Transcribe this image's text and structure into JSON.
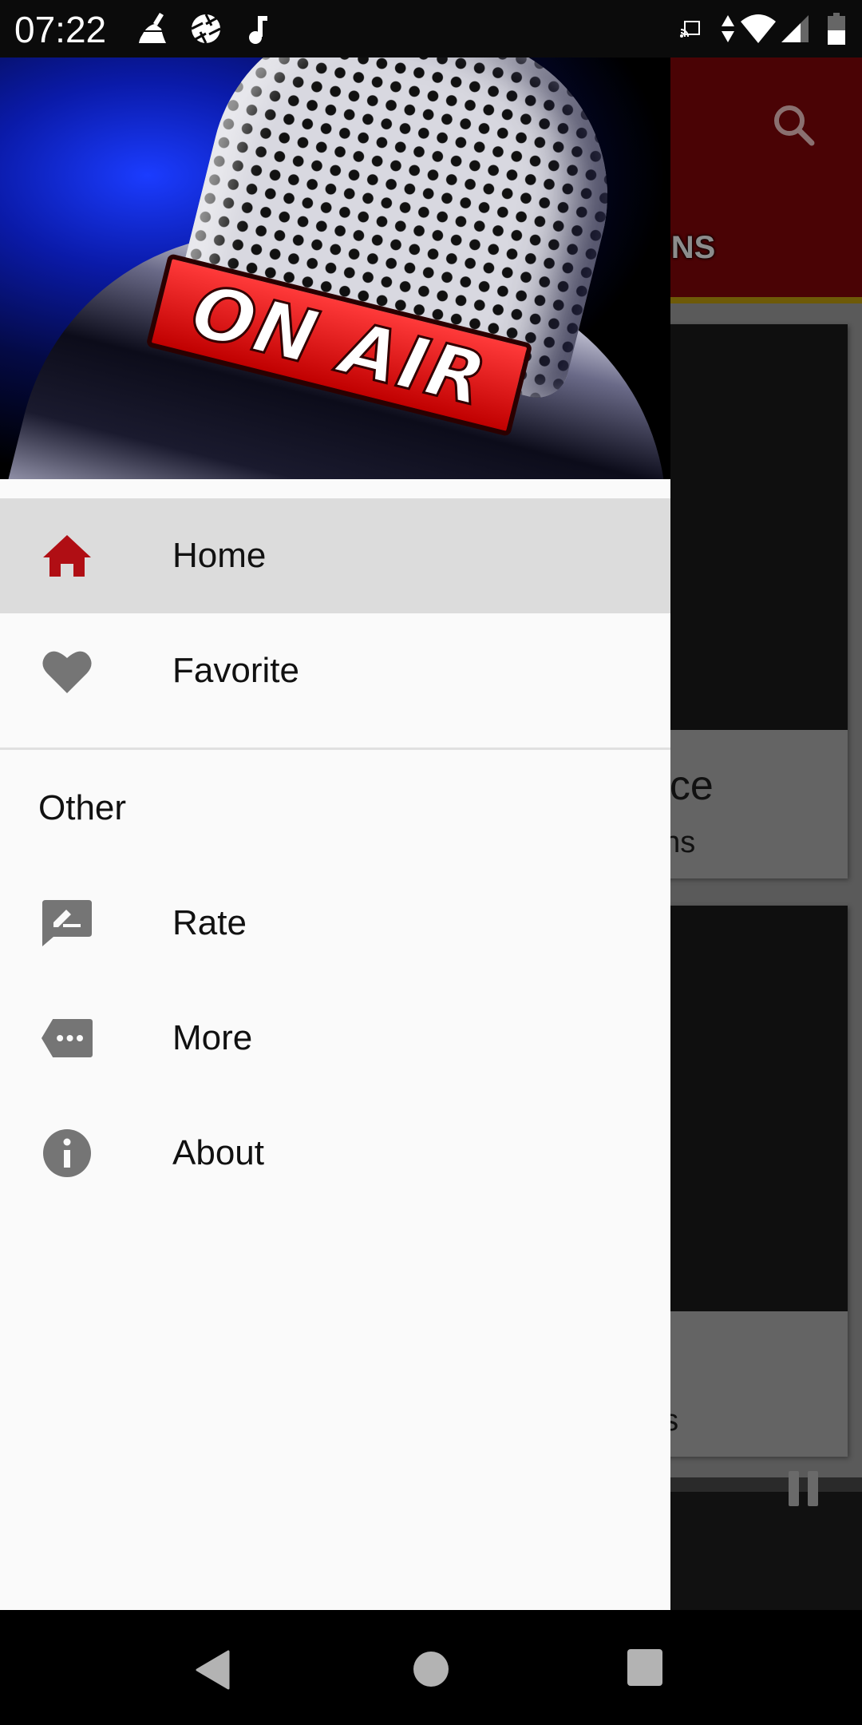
{
  "status_bar": {
    "time": "07:22",
    "left_icons": [
      "cleaner-broom-icon",
      "camera-aperture-icon",
      "music-note-icon"
    ],
    "right_icons": [
      "cast-icon",
      "data-arrows-icon",
      "wifi-icon",
      "cell-signal-icon",
      "battery-icon"
    ]
  },
  "background_app": {
    "toolbar": {
      "search_icon": "search-icon",
      "tab_label": "STATIONS",
      "color": "#4a0305",
      "accent_color": "#6e5a08"
    },
    "cards": [
      {
        "title_fragment": "rice",
        "subtitle_fragment": "ons"
      },
      {
        "title_fragment": "",
        "subtitle_fragment": "ns"
      }
    ],
    "player": {
      "pause_icon": "pause-icon"
    }
  },
  "drawer": {
    "header_image": {
      "text": "ON AIR",
      "description": "microphone-on-air-banner"
    },
    "primary_items": [
      {
        "label": "Home",
        "icon": "home-icon",
        "active": true
      },
      {
        "label": "Favorite",
        "icon": "heart-icon",
        "active": false
      }
    ],
    "section_title": "Other",
    "secondary_items": [
      {
        "label": "Rate",
        "icon": "rate-review-icon"
      },
      {
        "label": "More",
        "icon": "more-tag-icon"
      },
      {
        "label": "About",
        "icon": "info-icon"
      }
    ],
    "colors": {
      "active_icon": "#b00e14",
      "inactive_icon": "#757575",
      "active_bg": "#dcdcdc",
      "background": "#fafafa"
    }
  },
  "nav_bar": {
    "buttons": [
      "back",
      "home",
      "recents"
    ]
  }
}
